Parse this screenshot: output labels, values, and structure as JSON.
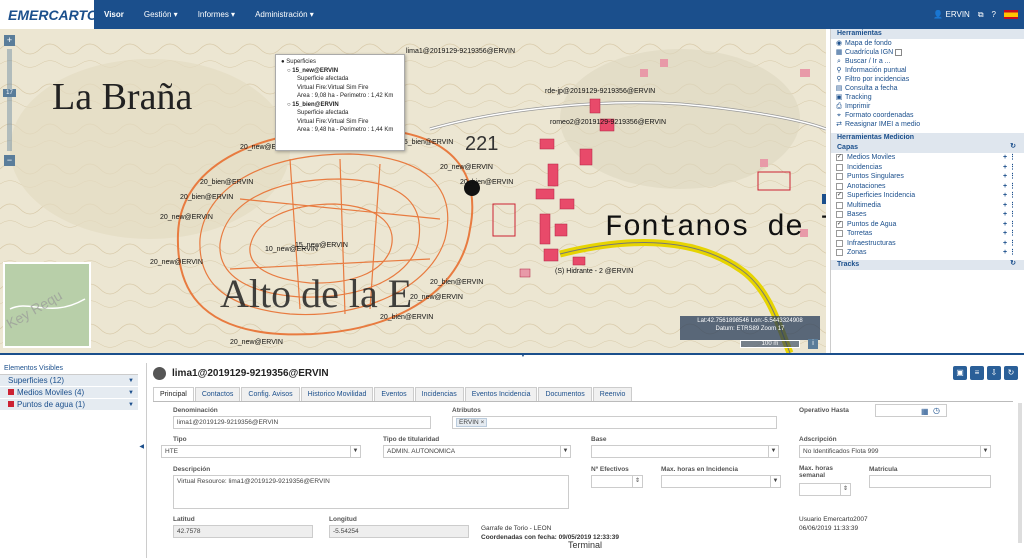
{
  "header": {
    "logo_text": "EMERCARTO",
    "nav": [
      {
        "label": "Visor",
        "active": true
      },
      {
        "label": "Gestión",
        "arrow": true
      },
      {
        "label": "Informes",
        "arrow": true
      },
      {
        "label": "Administración",
        "arrow": true
      }
    ],
    "user": "ERVIN",
    "brand_color": "#1b4f8c"
  },
  "map": {
    "place_labels": [
      "La Braña",
      "Alto de la E",
      "Fontanos de T"
    ],
    "number_label": "221",
    "popup": {
      "title": "Superficies",
      "items": [
        {
          "name": "15_new@ERVIN",
          "line1": "Superficie afectada",
          "line2": "Virtual Fire:Virtual Sim Fire",
          "line3": "Area : 9,08 ha - Perimetro : 1,42 Km"
        },
        {
          "name": "15_bien@ERVIN",
          "line1": "Superficie afectada",
          "line2": "Virtual Fire:Virtual Sim Fire",
          "line3": "Area : 9,48 ha - Perimetro : 1,44 Km"
        }
      ]
    },
    "resource_labels": [
      "lima1@2019129-9219356@ERVIN",
      "rde-jp@2019129-9219356@ERVIN",
      "romeo2@2019129-9219356@ERVIN",
      "20_new@ERVIN",
      "20_bien@ERVIN",
      "10_new@ERVIN",
      "15_new@ERVIN",
      "15_bien@ERVIN",
      "(S) Hidrante - 2 @ERVIN"
    ],
    "coords_line1": "Lat:42.7561898546 Lon:-5.5443324908",
    "coords_line2": "Datum: ETRS89 Zoom 17",
    "scale": "100 m",
    "minimap_text": "Key Requ",
    "zoom_level_label": "17"
  },
  "right_panel": {
    "tools_title": "Herramientas",
    "tools": [
      "Mapa de fondo",
      "Cuadrícula IGN",
      "Buscar / Ir a ...",
      "Información puntual",
      "Filtro por incidencias",
      "Consulta a fecha",
      "Tracking",
      "Imprimir",
      "Formato coordenadas",
      "Reasignar IMEI a medio"
    ],
    "medicion_title": "Herramientas Medicion",
    "capas_title": "Capas",
    "layers": [
      {
        "label": "Medios Moviles",
        "checked": true
      },
      {
        "label": "Incidencias",
        "checked": false
      },
      {
        "label": "Puntos Singulares",
        "checked": false
      },
      {
        "label": "Anotaciones",
        "checked": false
      },
      {
        "label": "Superficies Incidencia",
        "checked": true
      },
      {
        "label": "Multimedia",
        "checked": false
      },
      {
        "label": "Bases",
        "checked": false
      },
      {
        "label": "Puntos de Agua",
        "checked": true
      },
      {
        "label": "Torretas",
        "checked": false
      },
      {
        "label": "Infraestructuras",
        "checked": false
      },
      {
        "label": "Zonas",
        "checked": false
      }
    ],
    "tracks_title": "Tracks"
  },
  "elements": {
    "title": "Elementos Visibles",
    "items": [
      "Superficies (12)",
      "Medios Moviles (4)",
      "Puntos de agua (1)"
    ]
  },
  "detail": {
    "title": "lima1@2019129-9219356@ERVIN",
    "tabs": [
      "Principal",
      "Contactos",
      "Config. Avisos",
      "Historico Movilidad",
      "Eventos",
      "Incidencias",
      "Eventos Incidencia",
      "Documentos",
      "Reenvio"
    ],
    "denominacion_label": "Denominación",
    "denominacion": "lima1@2019129-9219356@ERVIN",
    "atributos_label": "Atributos",
    "atributo_tag": "ERVIN ×",
    "operativo_label": "Operativo Hasta",
    "tipo_label": "Tipo",
    "tipo": "HTE",
    "titularidad_label": "Tipo de titularidad",
    "titularidad": "ADMIN. AUTONOMICA",
    "base_label": "Base",
    "adscripcion_label": "Adscripción",
    "adscripcion": "No Identificados Flota 999",
    "descripcion_label": "Descripción",
    "descripcion": "Virtual Resource: lima1@2019129-9219356@ERVIN",
    "efectivos_label": "Nº Efectivos",
    "max_incidencia_label": "Max. horas en Incidencia",
    "max_semanal_label": "Max. horas semanal",
    "matricula_label": "Matricula",
    "latitud_label": "Latitud",
    "latitud": "42.7578",
    "longitud_label": "Longitud",
    "longitud": "-5.54254",
    "location": "Garrafe de Torio - LEON",
    "coords_date": "Coordenadas con fecha: 09/05/2019 12:33:39",
    "user_line": "Usuario Emercarto2007",
    "user_date": "06/06/2019 11:33:39",
    "status": "Terminal"
  }
}
